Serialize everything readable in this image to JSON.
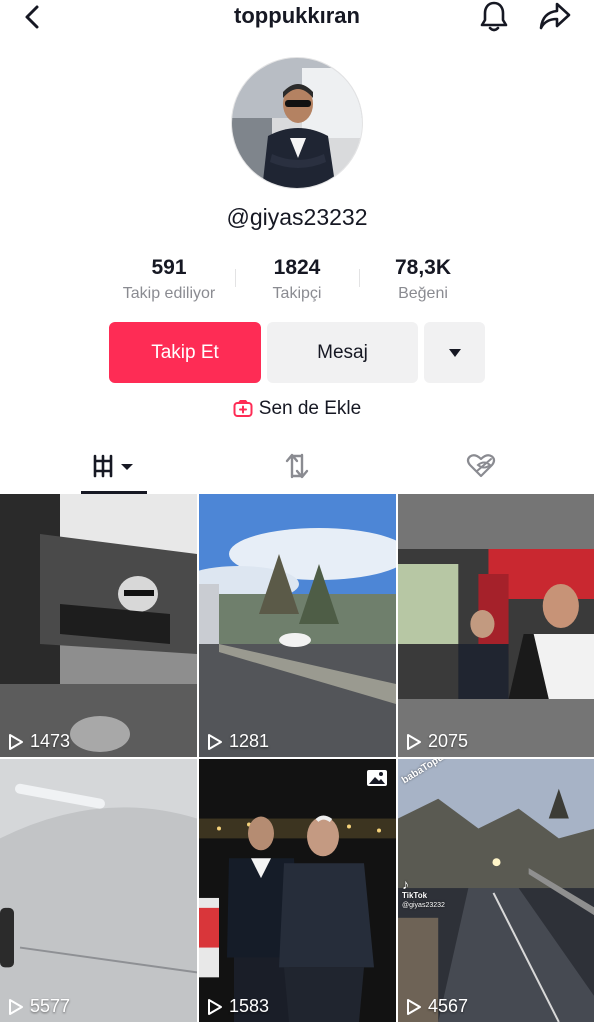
{
  "header": {
    "title": "toppukkıran",
    "back_icon": "chevron-left-icon",
    "bell_icon": "bell-icon",
    "share_icon": "share-arrow-icon"
  },
  "profile": {
    "username": "@giyas23232"
  },
  "stats": [
    {
      "value": "591",
      "label": "Takip ediliyor"
    },
    {
      "value": "1824",
      "label": "Takipçi"
    },
    {
      "value": "78,3K",
      "label": "Beğeni"
    }
  ],
  "actions": {
    "follow_label": "Takip Et",
    "message_label": "Mesaj",
    "more_icon": "caret-down-icon"
  },
  "add": {
    "label": "Sen de Ekle",
    "icon": "add-friend-icon"
  },
  "tabs": [
    {
      "name": "videos",
      "icon": "video-grid-icon",
      "active": true
    },
    {
      "name": "reposts",
      "icon": "repost-icon",
      "active": false
    },
    {
      "name": "liked",
      "icon": "liked-hidden-icon",
      "active": false
    }
  ],
  "videos": [
    {
      "views": "1473"
    },
    {
      "views": "1281"
    },
    {
      "views": "2075"
    },
    {
      "views": "5577"
    },
    {
      "views": "1583",
      "photo_badge": true
    },
    {
      "views": "4567",
      "watermark": "babaTopukkıran",
      "tiktok_logo_text": "TikTok",
      "tiktok_handle": "@giyas23232"
    }
  ],
  "colors": {
    "accent": "#fe2c55",
    "button_grey": "#f1f1f2",
    "text_primary": "#161823",
    "text_secondary": "#8a8b91"
  }
}
